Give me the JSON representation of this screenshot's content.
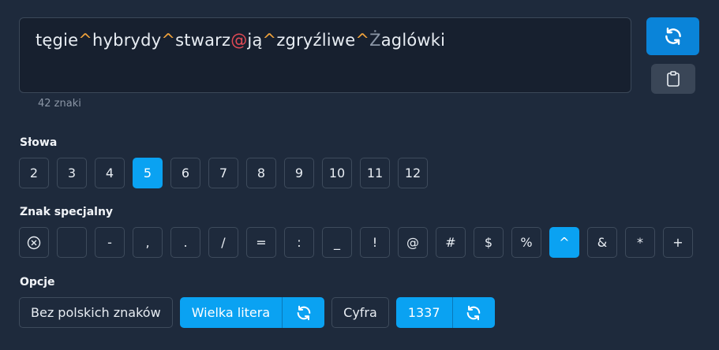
{
  "password": {
    "segments": [
      {
        "text": "tęgie",
        "kind": "word"
      },
      {
        "text": "^",
        "kind": "sep"
      },
      {
        "text": "hybrydy",
        "kind": "word"
      },
      {
        "text": "^",
        "kind": "sep"
      },
      {
        "text": "stwarz",
        "kind": "word"
      },
      {
        "text": "@",
        "kind": "digit"
      },
      {
        "text": "ją",
        "kind": "word"
      },
      {
        "text": "^",
        "kind": "sep"
      },
      {
        "text": "zgryźliwe",
        "kind": "word"
      },
      {
        "text": "^",
        "kind": "sep"
      },
      {
        "text": "Ż",
        "kind": "letter"
      },
      {
        "text": "aglówki",
        "kind": "word"
      }
    ],
    "count_label": "42 znaki"
  },
  "icons": {
    "refresh": "refresh-icon",
    "copy": "clipboard-icon",
    "clear": "circle-x-icon"
  },
  "colors": {
    "accent": "#0aa2f2",
    "primary_button": "#0a84d9",
    "separator": "#f0a23b",
    "digit": "#e24a55"
  },
  "words": {
    "label": "Słowa",
    "options": [
      "2",
      "3",
      "4",
      "5",
      "6",
      "7",
      "8",
      "9",
      "10",
      "11",
      "12"
    ],
    "selected": "5"
  },
  "special": {
    "label": "Znak specjalny",
    "options": [
      "",
      "-",
      ",",
      ".",
      "/",
      "=",
      ":",
      "_",
      "!",
      "@",
      "#",
      "$",
      "%",
      "^",
      "&",
      "*",
      "+"
    ],
    "selected": "^"
  },
  "options": {
    "label": "Opcje",
    "no_polish": "Bez polskich znaków",
    "uppercase": "Wielka litera",
    "digit": "Cyfra",
    "leet": "1337"
  }
}
